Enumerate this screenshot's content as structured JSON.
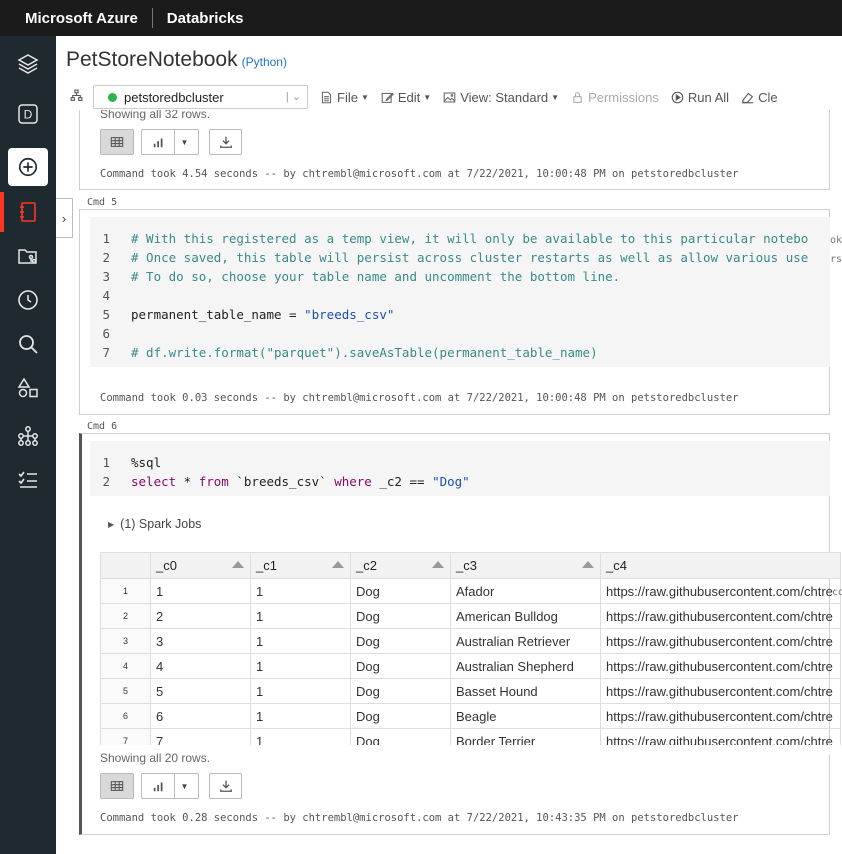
{
  "topbar": {
    "brand": "Microsoft Azure",
    "product": "Databricks"
  },
  "rail": {
    "items": [
      "layers-icon",
      "workspace-d-icon",
      "create-plus-icon",
      "notebook-icon",
      "repos-icon",
      "recent-clock-icon",
      "search-icon",
      "shapes-icon",
      "cluster-tree-icon",
      "jobs-list-icon"
    ],
    "workspace_letter": "D",
    "accent": "#ff3621"
  },
  "notebook": {
    "title": "PetStoreNotebook",
    "language": "(Python)"
  },
  "toolbar": {
    "cluster": "petstoredbcluster",
    "cluster_status_color": "#2cb34a",
    "file": "File",
    "edit": "Edit",
    "view": "View: Standard",
    "permissions": "Permissions",
    "run_all": "Run All",
    "clear": "Cle"
  },
  "cell4": {
    "showing": "Showing all 32 rows.",
    "took": "Command took 4.54 seconds -- by chtrembl@microsoft.com at 7/22/2021, 10:00:48 PM on petstoredbcluster"
  },
  "cell5": {
    "label": "Cmd 5",
    "lines": [
      {
        "n": "1",
        "text": "# With this registered as a temp view, it will only be available to this particular notebo"
      },
      {
        "n": "2",
        "text": "# Once saved, this table will persist across cluster restarts as well as allow various use"
      },
      {
        "n": "3",
        "text": "# To do so, choose your table name and uncomment the bottom line."
      },
      {
        "n": "4",
        "text": ""
      },
      {
        "n": "5",
        "var": "permanent_table_name = ",
        "str": "\"breeds_csv\""
      },
      {
        "n": "6",
        "text": ""
      },
      {
        "n": "7",
        "text": "# df.write.format(\"parquet\").saveAsTable(permanent_table_name)"
      }
    ],
    "edge_fragments": [
      "ok",
      "rs"
    ],
    "took": "Command took 0.03 seconds -- by chtrembl@microsoft.com at 7/22/2021, 10:00:48 PM on petstoredbcluster"
  },
  "cell6": {
    "label": "Cmd 6",
    "line1": {
      "n": "1",
      "text": "%sql"
    },
    "line2": {
      "n": "2",
      "kw1": "select",
      "mid1": " * ",
      "kw2": "from",
      "mid2": " `breeds_csv` ",
      "kw3": "where",
      "mid3": " _c2 == ",
      "str": "\"Dog\""
    },
    "spark_jobs": "(1) Spark Jobs",
    "columns": [
      "_c0",
      "_c1",
      "_c2",
      "_c3",
      "_c4"
    ],
    "rows": [
      {
        "rn": "1",
        "c0": "1",
        "c1": "1",
        "c2": "Dog",
        "c3": "Afador",
        "c4": "https://raw.githubusercontent.com/chtre"
      },
      {
        "rn": "2",
        "c0": "2",
        "c1": "1",
        "c2": "Dog",
        "c3": "American Bulldog",
        "c4": "https://raw.githubusercontent.com/chtre"
      },
      {
        "rn": "3",
        "c0": "3",
        "c1": "1",
        "c2": "Dog",
        "c3": "Australian Retriever",
        "c4": "https://raw.githubusercontent.com/chtre"
      },
      {
        "rn": "4",
        "c0": "4",
        "c1": "1",
        "c2": "Dog",
        "c3": "Australian Shepherd",
        "c4": "https://raw.githubusercontent.com/chtre"
      },
      {
        "rn": "5",
        "c0": "5",
        "c1": "1",
        "c2": "Dog",
        "c3": "Basset Hound",
        "c4": "https://raw.githubusercontent.com/chtre"
      },
      {
        "rn": "6",
        "c0": "6",
        "c1": "1",
        "c2": "Dog",
        "c3": "Beagle",
        "c4": "https://raw.githubusercontent.com/chtre"
      },
      {
        "rn": "7",
        "c0": "7",
        "c1": "1",
        "c2": "Dog",
        "c3": "Border Terrier",
        "c4": "https://raw.githubusercontent.com/chtre"
      }
    ],
    "edge_fragment": "co",
    "showing": "Showing all 20 rows.",
    "took": "Command took 0.28 seconds -- by chtrembl@microsoft.com at 7/22/2021, 10:43:35 PM on petstoredbcluster"
  }
}
